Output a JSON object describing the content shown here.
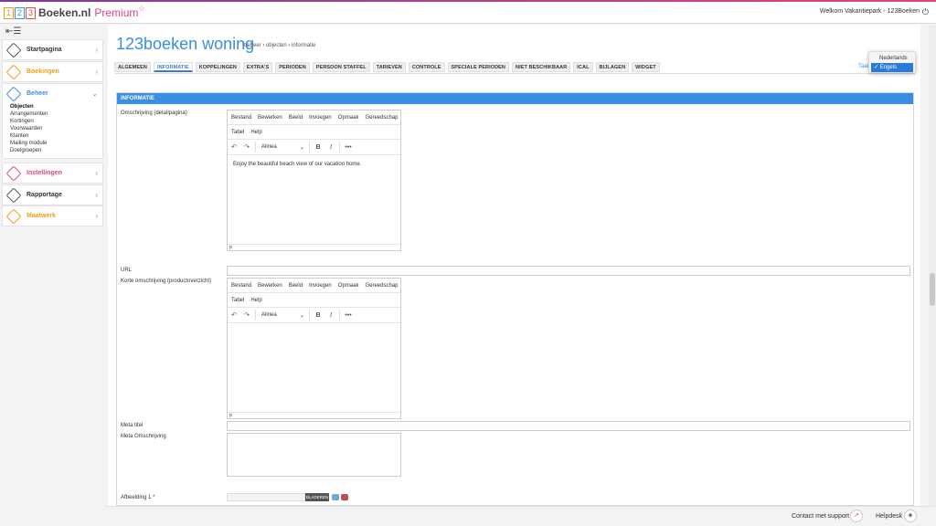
{
  "brand": {
    "box1": "1",
    "box2": "2",
    "box3": "3",
    "name": "Boeken.nl",
    "premium": "Premium",
    "star": "☆"
  },
  "header": {
    "welcome": "Welkom Vakantiepark - 123Boeken",
    "power_icon": "⏻"
  },
  "sidebar": {
    "toggle": "⇤☰",
    "items": [
      {
        "label": "Startpagina",
        "color": "#333333"
      },
      {
        "label": "Boekingen",
        "color": "#f39c12"
      },
      {
        "label": "Beheer",
        "color": "#3a8ee6",
        "chevron": "⌄"
      },
      {
        "label": "Instellingen",
        "color": "#e0457b"
      },
      {
        "label": "Rapportage",
        "color": "#333333"
      },
      {
        "label": "Maatwerk",
        "color": "#f39c12"
      }
    ],
    "beheer_sub": [
      "Objecten",
      "Arrangementen",
      "Kortingen",
      "Voorwaarden",
      "Klanten",
      "Mailing module",
      "Doelgroepen"
    ],
    "chevron": "›"
  },
  "page": {
    "title": "123boeken woning",
    "breadcrumb": "beheer › objecten › informatie"
  },
  "tabs": [
    "ALGEMEEN",
    "INFORMATIE",
    "KOPPELINGEN",
    "EXTRA'S",
    "PERIODEN",
    "PERSOON STAFFEL",
    "TARIEVEN",
    "CONTROLE",
    "SPECIALE PERIODEN",
    "NIET BESCHIKBAAR",
    "ICAL",
    "BIJLAGEN",
    "WIDGET"
  ],
  "active_tab": "INFORMATIE",
  "language": {
    "label": "Taal",
    "options": [
      "Nederlands",
      "Engels"
    ],
    "selected": "✓ Engels"
  },
  "panel": {
    "title": "INFORMATIE"
  },
  "form": {
    "omschrijving_label": "Omschrijving (detailpagina)",
    "url_label": "URL",
    "korte_label": "Korte omschrijving (productoverzicht)",
    "meta_titel_label": "Meta titel",
    "meta_omschrijving_label": "Meta Omschrijving",
    "afbeelding1_label": "Afbeelding 1 *",
    "browse_label": "BLADEREN"
  },
  "editor": {
    "menu_row1": [
      "Bestand",
      "Bewerken",
      "Beeld",
      "Invoegen",
      "Opmaak",
      "Gereedschap"
    ],
    "menu_row2": [
      "Tabel",
      "Help"
    ],
    "undo": "↶",
    "redo": "↷",
    "block_format": "Alinea",
    "dropdown": "⌄",
    "bold": "B",
    "italic": "I",
    "more": "•••",
    "status": "p",
    "content1": "Enjoy the beautiful beach view of our vacation home.",
    "content2": ""
  },
  "footer": {
    "support": "Contact met support",
    "helpdesk": "Helpdesk"
  }
}
